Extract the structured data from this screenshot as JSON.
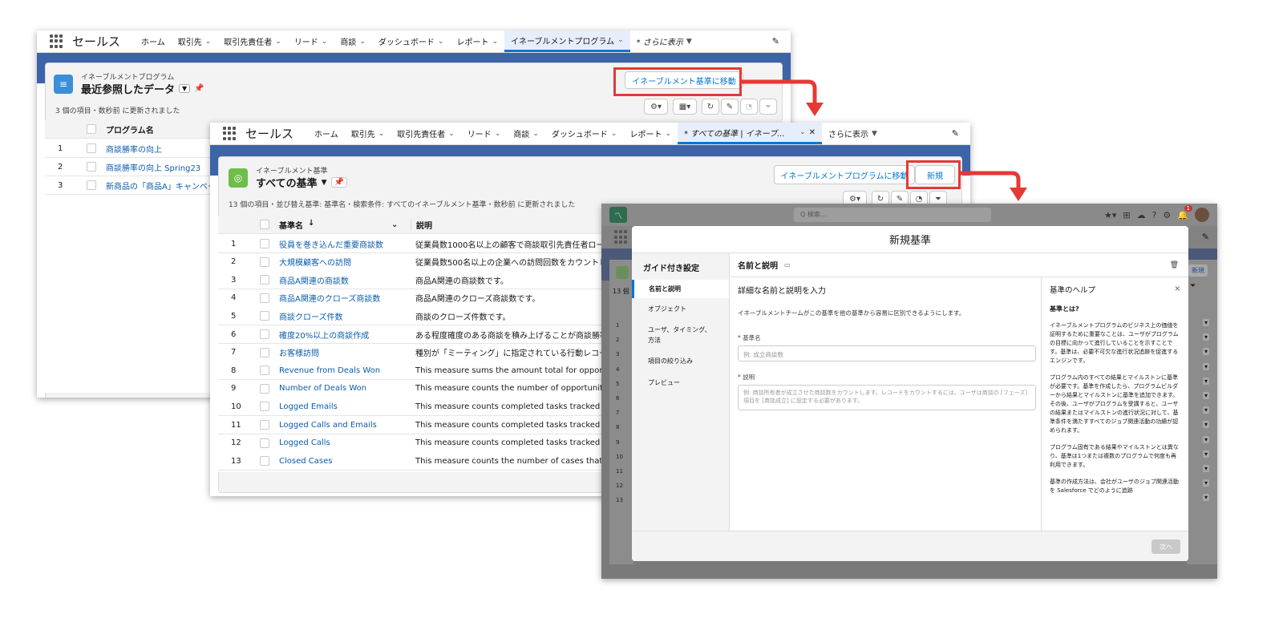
{
  "w1": {
    "app": "セールス",
    "nav": [
      "ホーム",
      "取引先",
      "取引先責任者",
      "リード",
      "商談",
      "ダッシュボード",
      "レポート",
      "イネーブルメントプログラム",
      "* さらに表示"
    ],
    "object": "イネーブルメントプログラム",
    "list_view": "最近参照したデータ",
    "action_button": "イネーブルメント基準に移動",
    "status": "3 個の項目・数秒前 に更新されました",
    "col_name": "プログラム名",
    "rows": [
      {
        "n": "1",
        "name": "商談勝率の向上"
      },
      {
        "n": "2",
        "name": "商談勝率の向上 Spring23"
      },
      {
        "n": "3",
        "name": "新商品の「商品A」キャンペー"
      }
    ]
  },
  "w2": {
    "app": "セールス",
    "nav": [
      "ホーム",
      "取引先",
      "取引先責任者",
      "リード",
      "商談",
      "ダッシュボード",
      "レポート",
      "* すべての基準 | イネーブ...",
      "さらに表示"
    ],
    "object": "イネーブルメント基準",
    "list_view": "すべての基準",
    "move_button": "イネーブルメントプログラムに移動",
    "new_button": "新規",
    "status": "13 個の項目・並び替え基準: 基準名・検索条件: すべてのイネーブルメント基準・数秒前 に更新されました",
    "col_name": "基準名",
    "col_desc": "説明",
    "rows": [
      {
        "n": "1",
        "name": "役員を巻き込んだ重要商談数",
        "desc": "従業員数1000名以上の顧客で商談取引先責任者ロールに"
      },
      {
        "n": "2",
        "name": "大規模顧客への訪問",
        "desc": "従業員数500名以上の企業への訪問回数をカウントします"
      },
      {
        "n": "3",
        "name": "商品A関連の商談数",
        "desc": "商品A関連の商談数です。"
      },
      {
        "n": "4",
        "name": "商品A関連のクローズ商談数",
        "desc": "商品A関連のクローズ商談数です。"
      },
      {
        "n": "5",
        "name": "商談クローズ件数",
        "desc": "商談のクローズ件数です。"
      },
      {
        "n": "6",
        "name": "確度20%以上の商談作成",
        "desc": "ある程度確度のある商談を積み上げることが商談勝率の"
      },
      {
        "n": "7",
        "name": "お客様訪問",
        "desc": "種別が「ミーティング」に指定されている行動レコード"
      },
      {
        "n": "8",
        "name": "Revenue from Deals Won",
        "desc": "This measure sums the amount total for opportunities"
      },
      {
        "n": "9",
        "name": "Number of Deals Won",
        "desc": "This measure counts the number of opportunities that"
      },
      {
        "n": "10",
        "name": "Logged Emails",
        "desc": "This measure counts completed tasks tracked as emai"
      },
      {
        "n": "11",
        "name": "Logged Calls and Emails",
        "desc": "This measure counts completed tasks tracked as calls"
      },
      {
        "n": "12",
        "name": "Logged Calls",
        "desc": "This measure counts completed tasks tracked as calls."
      },
      {
        "n": "13",
        "name": "Closed Cases",
        "desc": "This measure counts the number of cases that a case"
      }
    ]
  },
  "w3": {
    "search_placeholder": "Q 検索...",
    "notif_count": "1",
    "modal_title": "新規基準",
    "guide_title": "ガイド付き設定",
    "steps": [
      "名前と説明",
      "オブジェクト",
      "ユーザ、タイミング、方法",
      "項目の絞り込み",
      "プレビュー"
    ],
    "section_title": "名前と説明",
    "form_heading": "詳細な名前と説明を入力",
    "form_intro": "イネーブルメントチームがこの基準を他の基準から容易に区別できるようにします。",
    "name_label": "* 基準名",
    "name_placeholder": "例: 成立商談数",
    "desc_label": "* 説明",
    "desc_placeholder": "例: 商談所有者が成立させた商談数をカウントします。レコードをカウントするには、ユーザは商談の [フェーズ] 項目を [商談成立] に設定する必要があります。",
    "help_title": "基準のヘルプ",
    "help_sub": "基準とは?",
    "help_p1": "イネーブルメントプログラムのビジネス上の価値を証明するために重要なことは、ユーザがプログラムの目標に向かって進行していることを示すことです。基準は、必要不可欠な進行状況追跡を促進するエンジンです。",
    "help_p2": "プログラム内のすべての結果とマイルストンに基準が必要です。基準を作成したら、プログラムビルダーから結果とマイルストンに基準を追加できます。その後、ユーザがプログラムを受講すると、ユーザの結果またはマイルストンの進行状況に対して、基準条件を満たすすべてのジョブ関連活動の功績が認められます。",
    "help_p3": "プログラム固有である結果やマイルストンとは異なり、基準は1つまたは複数のプログラムで何度も再利用できます。",
    "help_p4": "基準の作成方法は、会社がユーザのジョブ関連活動を Salesforce でどのように追跡",
    "next_button": "次へ",
    "bg_status": "13 個",
    "bg_rows": [
      "1",
      "2",
      "3",
      "4",
      "5",
      "6",
      "7",
      "8",
      "9",
      "10",
      "11",
      "12",
      "13"
    ],
    "bg_side_button": "新規"
  },
  "colors": {
    "brand": "#0176d3",
    "red": "#e53935",
    "band": "#3c64a6"
  }
}
